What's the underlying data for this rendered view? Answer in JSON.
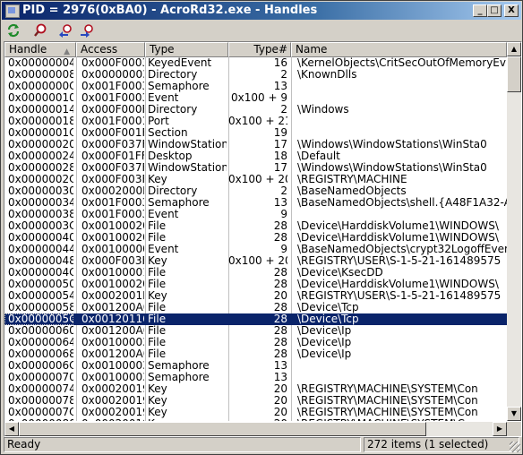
{
  "window": {
    "title": "PID = 2976(0xBA0) - AcroRd32.exe - Handles",
    "minimize_label": "_",
    "maximize_label": "□",
    "close_label": "X"
  },
  "toolbar": {
    "icons": [
      "refresh-icon",
      "find-icon",
      "back-icon",
      "forward-icon"
    ]
  },
  "table": {
    "columns": [
      "Handle",
      "Access",
      "Type",
      "Type#",
      "Name"
    ],
    "sort_indicator": "▲",
    "rows": [
      {
        "handle": "0x00000004",
        "access": "0x000F0003",
        "type": "KeyedEvent",
        "typen": "16",
        "name": "\\KernelObjects\\CritSecOutOfMemoryEv"
      },
      {
        "handle": "0x00000008",
        "access": "0x00000003",
        "type": "Directory",
        "typen": "2",
        "name": "\\KnownDlls"
      },
      {
        "handle": "0x0000000C",
        "access": "0x001F0003",
        "type": "Semaphore",
        "typen": "13",
        "name": ""
      },
      {
        "handle": "0x00000010",
        "access": "0x001F0003",
        "type": "Event",
        "typen": "0x100 + 9",
        "name": ""
      },
      {
        "handle": "0x00000014",
        "access": "0x000F000F",
        "type": "Directory",
        "typen": "2",
        "name": "\\Windows"
      },
      {
        "handle": "0x00000018",
        "access": "0x001F0001",
        "type": "Port",
        "typen": "0x100 + 21",
        "name": ""
      },
      {
        "handle": "0x0000001C",
        "access": "0x000F001F",
        "type": "Section",
        "typen": "19",
        "name": ""
      },
      {
        "handle": "0x00000020",
        "access": "0x000F037F",
        "type": "WindowStation",
        "typen": "17",
        "name": "\\Windows\\WindowStations\\WinSta0"
      },
      {
        "handle": "0x00000024",
        "access": "0x000F01FF",
        "type": "Desktop",
        "typen": "18",
        "name": "\\Default"
      },
      {
        "handle": "0x00000028",
        "access": "0x000F037F",
        "type": "WindowStation",
        "typen": "17",
        "name": "\\Windows\\WindowStations\\WinSta0"
      },
      {
        "handle": "0x0000002C",
        "access": "0x000F003F",
        "type": "Key",
        "typen": "0x100 + 20",
        "name": "\\REGISTRY\\MACHINE"
      },
      {
        "handle": "0x00000030",
        "access": "0x0002000F",
        "type": "Directory",
        "typen": "2",
        "name": "\\BaseNamedObjects"
      },
      {
        "handle": "0x00000034",
        "access": "0x001F0003",
        "type": "Semaphore",
        "typen": "13",
        "name": "\\BaseNamedObjects\\shell.{A48F1A32-A"
      },
      {
        "handle": "0x00000038",
        "access": "0x001F0003",
        "type": "Event",
        "typen": "9",
        "name": ""
      },
      {
        "handle": "0x0000003C",
        "access": "0x00100020",
        "type": "File",
        "typen": "28",
        "name": "\\Device\\HarddiskVolume1\\WINDOWS\\"
      },
      {
        "handle": "0x00000040",
        "access": "0x00100020",
        "type": "File",
        "typen": "28",
        "name": "\\Device\\HarddiskVolume1\\WINDOWS\\"
      },
      {
        "handle": "0x00000044",
        "access": "0x00100000",
        "type": "Event",
        "typen": "9",
        "name": "\\BaseNamedObjects\\crypt32LogoffEven"
      },
      {
        "handle": "0x00000048",
        "access": "0x000F003F",
        "type": "Key",
        "typen": "0x100 + 20",
        "name": "\\REGISTRY\\USER\\S-1-5-21-161489575"
      },
      {
        "handle": "0x0000004C",
        "access": "0x00100001",
        "type": "File",
        "typen": "28",
        "name": "\\Device\\KsecDD"
      },
      {
        "handle": "0x00000050",
        "access": "0x00100020",
        "type": "File",
        "typen": "28",
        "name": "\\Device\\HarddiskVolume1\\WINDOWS\\"
      },
      {
        "handle": "0x00000054",
        "access": "0x0002001F",
        "type": "Key",
        "typen": "20",
        "name": "\\REGISTRY\\USER\\S-1-5-21-161489575"
      },
      {
        "handle": "0x00000058",
        "access": "0x001200A0",
        "type": "File",
        "typen": "28",
        "name": "\\Device\\Tcp"
      },
      {
        "handle": "0x0000005C",
        "access": "0x00120116",
        "type": "File",
        "typen": "28",
        "name": "\\Device\\Tcp",
        "selected": true
      },
      {
        "handle": "0x00000060",
        "access": "0x001200A0",
        "type": "File",
        "typen": "28",
        "name": "\\Device\\Ip"
      },
      {
        "handle": "0x00000064",
        "access": "0x00100003",
        "type": "File",
        "typen": "28",
        "name": "\\Device\\Ip"
      },
      {
        "handle": "0x00000068",
        "access": "0x001200A0",
        "type": "File",
        "typen": "28",
        "name": "\\Device\\Ip"
      },
      {
        "handle": "0x0000006C",
        "access": "0x00100003",
        "type": "Semaphore",
        "typen": "13",
        "name": ""
      },
      {
        "handle": "0x00000070",
        "access": "0x00100003",
        "type": "Semaphore",
        "typen": "13",
        "name": ""
      },
      {
        "handle": "0x00000074",
        "access": "0x00020019",
        "type": "Key",
        "typen": "20",
        "name": "\\REGISTRY\\MACHINE\\SYSTEM\\Con"
      },
      {
        "handle": "0x00000078",
        "access": "0x00020019",
        "type": "Key",
        "typen": "20",
        "name": "\\REGISTRY\\MACHINE\\SYSTEM\\Con"
      },
      {
        "handle": "0x0000007C",
        "access": "0x00020019",
        "type": "Key",
        "typen": "20",
        "name": "\\REGISTRY\\MACHINE\\SYSTEM\\Con"
      },
      {
        "handle": "0x00000080",
        "access": "0x00020019",
        "type": "Key",
        "typen": "20",
        "name": "\\REGISTRY\\MACHINE\\SYSTEM\\Con"
      }
    ]
  },
  "status": {
    "left": "Ready",
    "right": "272 items (1 selected)"
  }
}
